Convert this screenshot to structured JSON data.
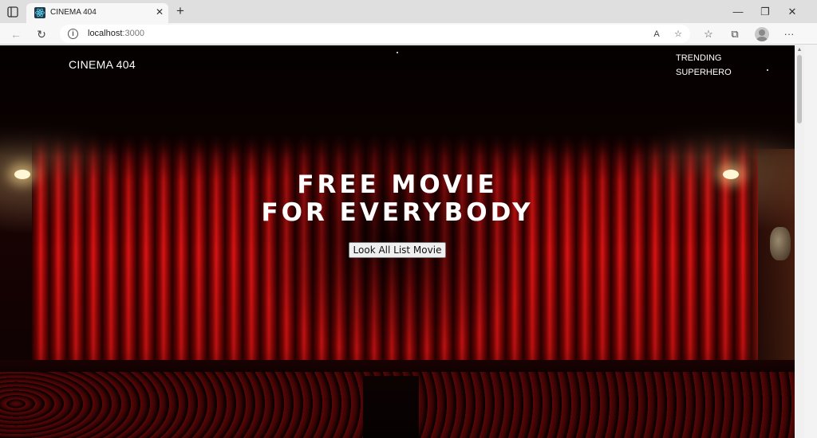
{
  "browser": {
    "tab": {
      "title": "CINEMA 404",
      "close_glyph": "✕"
    },
    "new_tab_glyph": "+",
    "window_controls": {
      "minimize": "—",
      "restore": "❐",
      "close": "✕"
    },
    "nav": {
      "back": "←",
      "refresh": "↻"
    },
    "address": {
      "info": "i",
      "host": "localhost",
      "port": ":3000"
    },
    "address_icons": {
      "read_aloud": "A",
      "favorite": "☆"
    },
    "toolbar_icons": {
      "favorites": "☆",
      "collections": "⧉",
      "menu": "···"
    }
  },
  "site": {
    "brand": "CINEMA 404",
    "nav_links": [
      "TRENDING",
      "SUPERHERO"
    ],
    "hero": {
      "line1": "FREE MOVIE",
      "line2": "FOR EVERYBODY",
      "button_label": "Look All List Movie"
    }
  },
  "colors": {
    "curtain_red": "#d91414",
    "background": "#050000",
    "text": "#ffffff"
  }
}
